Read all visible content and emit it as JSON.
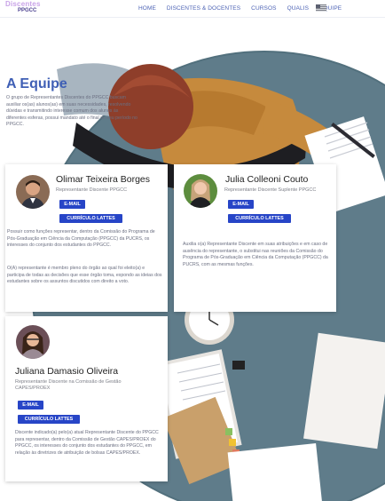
{
  "nav": {
    "logo_line1": "Discentes",
    "logo_line2": "PPGCC",
    "items": [
      {
        "label": "HOME"
      },
      {
        "label": "DISCENTES & DOCENTES"
      },
      {
        "label": "CURSOS"
      },
      {
        "label": "QUALIS"
      },
      {
        "label": "EQUIPE"
      }
    ],
    "language_icon": "us-flag-icon"
  },
  "hero": {
    "title": "A Equipe",
    "text": "O grupo de Representantes Discentes do PPGCC buscam auxiliar os(as) alunos(as) em suas necessidades, resolvendo dúvidas e transmitindo interesse comum dos alunos às diferentes esferas, possui mandato até o final do seu período no PPGCC."
  },
  "members": [
    {
      "name": "Olimar Teixeira Borges",
      "role": "Representante Discente PPGCC",
      "email_label": "E-MAIL",
      "lattes_label": "CURRÍCULO LATTES",
      "paragraphs": [
        "Possuir como funções representar, dentro da Comissão do Programa de Pós-Graduação em Ciência da Computação (PPGCC) da PUCRS, os interesses do conjunto dos estudantes do PPGCC.",
        "O(A) representante é membro pleno do órgão ao qual foi eleito(a) e participa de todas as decisões que esse órgão toma, expondo as ideias dos estudantes sobre os assuntos discutidos com direito a voto."
      ]
    },
    {
      "name": "Julia Colleoni Couto",
      "role": "Representante Discente Suplente PPGCC",
      "email_label": "E-MAIL",
      "lattes_label": "CURRÍCULO LATTES",
      "paragraphs": [
        "Auxilia o(a) Representante Discente em suas atribuições e em caso de ausência do representante, o substitui nas reuniões da Comissão do Programa de Pós-Graduação em Ciência da Computação (PPGCC) da PUCRS, com as mesmas funções."
      ]
    },
    {
      "name": "Juliana Damasio Oliveira",
      "role": "Representante Discente na Comissão de Gestão CAPES/PROEX",
      "email_label": "E-MAIL",
      "lattes_label": "CURRÍCULO LATTES",
      "paragraphs": [
        "Discente indicado(a) pelo(a) atual Representante Discente do PPGCC para representar, dentro da Comissão de Gestão CAPES/PROEX do PPGCC, os interesses do conjunto dos estudantes do PPGCC, em relação às diretrizes de atribuição de bolsas CAPES/PROEX."
      ]
    }
  ],
  "colors": {
    "accent": "#3f5fb5",
    "button": "#2745c7",
    "desk": "#5f7c8a"
  }
}
